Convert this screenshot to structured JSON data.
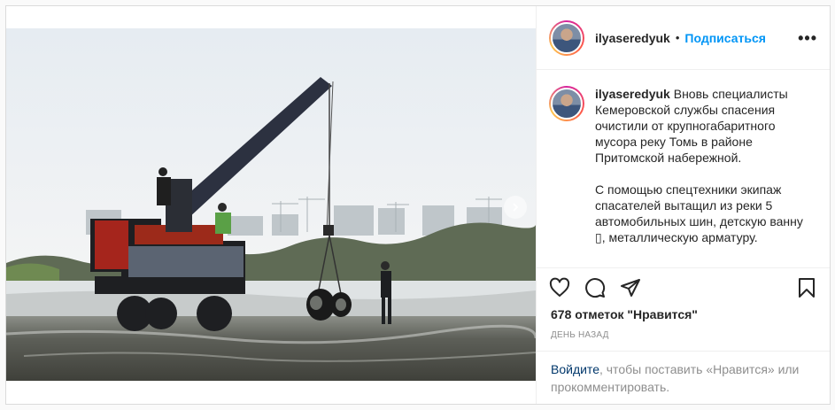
{
  "post": {
    "username": "ilyaseredyuk",
    "separator": "•",
    "follow_label": "Подписаться",
    "more_label": "•••",
    "photo_alt": "Кран вытаскивает шины из реки",
    "caption": "Вновь специалисты Кемеровской службы спасения очистили от крупногабаритного мусора реку Томь в районе Притомской набережной.\n\nС помощью спецтехники экипаж спасателей вытащил из реки 5 автомобильных шин, детскую ванну ▯, металлическую арматуру.",
    "likes": "678 отметок \"Нравится\"",
    "time": "День назад",
    "login_link": "Войдите",
    "login_text": ", чтобы поставить «Нравится» или прокомментировать."
  },
  "icons": {
    "like": "heart-icon",
    "comment": "comment-icon",
    "share": "paper-plane-icon",
    "save": "bookmark-icon",
    "next": "chevron-right-icon"
  }
}
